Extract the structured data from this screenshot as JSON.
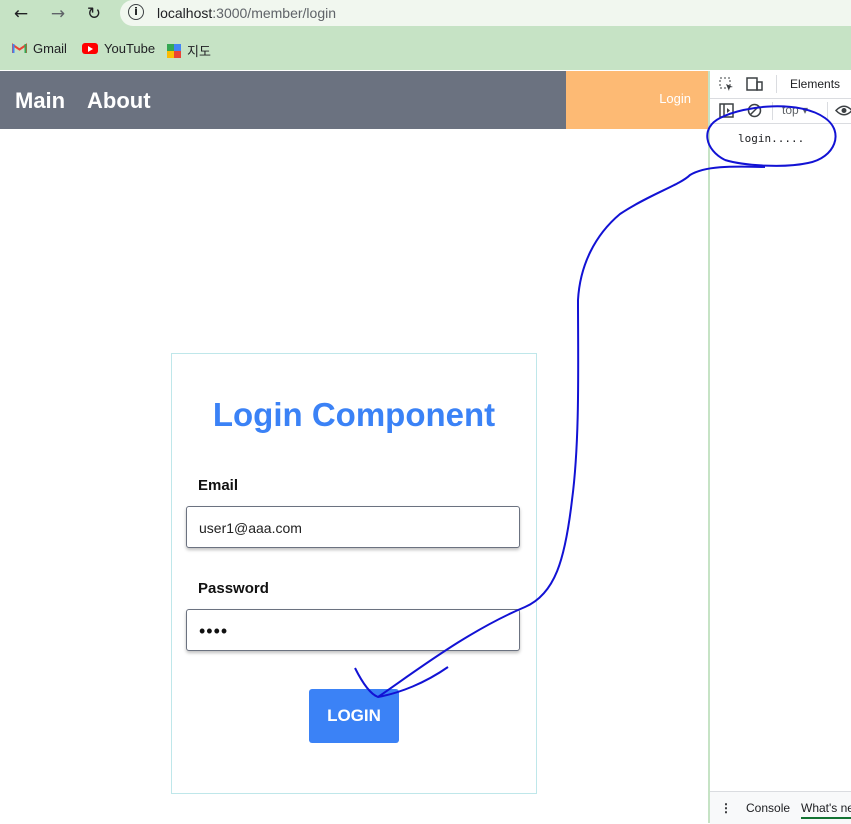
{
  "browser": {
    "url_host": "localhost",
    "url_path": ":3000/member/login",
    "bookmarks": [
      {
        "label": "Gmail"
      },
      {
        "label": "YouTube"
      },
      {
        "label": "지도"
      }
    ]
  },
  "app": {
    "nav": {
      "main": "Main",
      "about": "About",
      "login": "Login"
    },
    "login_card": {
      "title": "Login Component",
      "email_label": "Email",
      "email_value": "user1@aaa.com",
      "password_label": "Password",
      "password_value": "••••",
      "button_label": "LOGIN"
    }
  },
  "devtools": {
    "tab_elements": "Elements",
    "context": "top ▾",
    "console_output": "login.....",
    "bottom_tabs": [
      "Console",
      "What's new"
    ]
  },
  "colors": {
    "chrome": "#c6e3c5",
    "nav_bg": "#6b7280",
    "login_bg": "#fdba74",
    "accent": "#3b82f6",
    "annotation": "#1212d4"
  }
}
